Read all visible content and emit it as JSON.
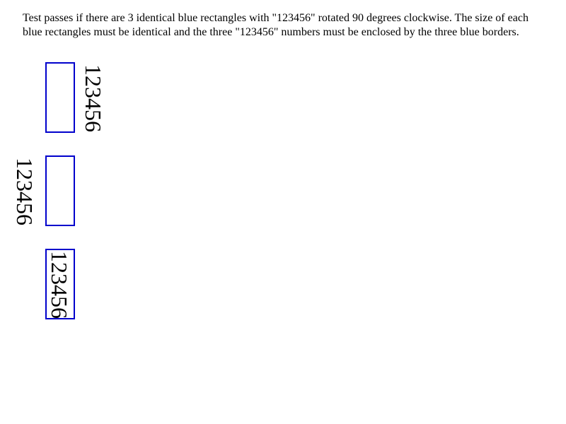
{
  "instructions": "Test passes if there are 3 identical blue rectangles with \"123456\" rotated 90 degrees clockwise. The size of each blue rectangles must be identical and the three \"123456\" numbers must be enclosed by the three blue borders.",
  "colors": {
    "border": "#0000cc"
  },
  "items": [
    {
      "text": "123456"
    },
    {
      "text": "123456"
    },
    {
      "text": "123456"
    }
  ]
}
